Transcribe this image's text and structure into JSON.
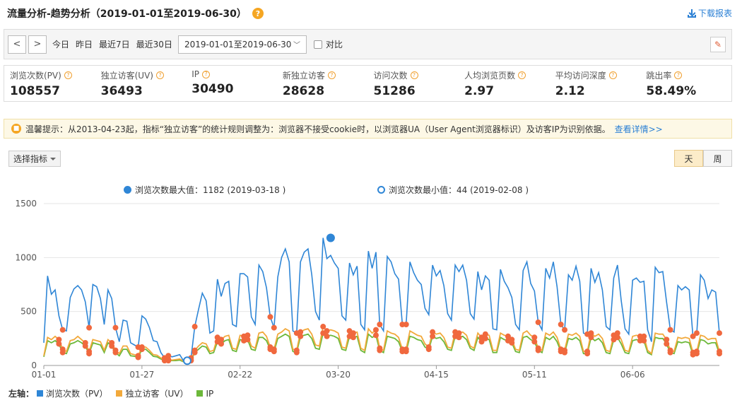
{
  "header": {
    "title": "流量分析-趋势分析（2019-01-01至2019-06-30）",
    "help": "?",
    "download": "下载报表"
  },
  "toolbar": {
    "prev": "<",
    "next": ">",
    "quick": [
      "今日",
      "昨日",
      "最近7日",
      "最近30日"
    ],
    "date_range": "2019-01-01至2019-06-30",
    "compare": "对比"
  },
  "metrics": [
    {
      "label": "浏览次数(PV)",
      "value": "108557"
    },
    {
      "label": "独立访客(UV)",
      "value": "36493"
    },
    {
      "label": "IP",
      "value": "30490"
    },
    {
      "label": "新独立访客",
      "value": "28628"
    },
    {
      "label": "访问次数",
      "value": "51286"
    },
    {
      "label": "人均浏览页数",
      "value": "2.97"
    },
    {
      "label": "平均访问深度",
      "value": "2.12"
    },
    {
      "label": "跳出率",
      "value": "58.49%"
    }
  ],
  "notice": {
    "text": "温馨提示：从2013-04-23起，指标“独立访客”的统计规则调整为：浏览器不接受cookie时，以浏览器UA（User Agent浏览器标识）及访客IP为识别依据。",
    "link": "查看详情>>"
  },
  "controls": {
    "metric_select": "选择指标",
    "granularity": [
      "天",
      "周"
    ],
    "granularity_active": "天"
  },
  "chart_legend_top": {
    "max": "浏览次数最大值：1182 (2019-03-18 )",
    "min": "浏览次数最小值：44 (2019-02-08 )"
  },
  "axis_legend": {
    "prefix": "左轴：",
    "items": [
      "浏览次数（PV）",
      "独立访客（UV）",
      "IP"
    ]
  },
  "colors": {
    "pv": "#2f86d6",
    "uv": "#f2a93b",
    "ip": "#6cb83a",
    "weekend_marker": "#f0683e"
  },
  "chart_data": {
    "type": "line",
    "title": "",
    "xlabel": "",
    "ylabel": "",
    "x_start": "2019-01-01",
    "x_end": "2019-06-30",
    "ylim": [
      0,
      1500
    ],
    "yticks": [
      0,
      500,
      1000,
      1500
    ],
    "xtick_labels": [
      "01-01",
      "01-27",
      "02-22",
      "03-20",
      "04-15",
      "05-11",
      "06-06"
    ],
    "grid": true,
    "max_point": {
      "date": "2019-03-18",
      "value": 1182
    },
    "min_point": {
      "date": "2019-02-08",
      "value": 44
    },
    "series": [
      {
        "name": "浏览次数（PV）",
        "key": "pv",
        "values": [
          210,
          830,
          660,
          700,
          460,
          330,
          320,
          630,
          710,
          740,
          700,
          590,
          350,
          750,
          730,
          620,
          380,
          700,
          620,
          350,
          220,
          420,
          410,
          210,
          190,
          170,
          460,
          430,
          350,
          230,
          220,
          120,
          70,
          90,
          80,
          90,
          100,
          44,
          50,
          70,
          360,
          520,
          670,
          600,
          300,
          320,
          800,
          640,
          760,
          780,
          380,
          360,
          850,
          850,
          820,
          450,
          380,
          930,
          870,
          720,
          450,
          350,
          820,
          1000,
          1080,
          960,
          320,
          300,
          960,
          1050,
          1080,
          840,
          500,
          420,
          1182,
          990,
          1020,
          950,
          900,
          460,
          420,
          950,
          840,
          920,
          380,
          330,
          1060,
          900,
          1050,
          380,
          320,
          1010,
          960,
          850,
          800,
          380,
          380,
          960,
          860,
          790,
          750,
          530,
          470,
          930,
          830,
          880,
          740,
          480,
          420,
          930,
          870,
          930,
          790,
          480,
          430,
          870,
          700,
          830,
          790,
          340,
          330,
          890,
          780,
          720,
          630,
          380,
          330,
          880,
          960,
          760,
          690,
          400,
          330,
          900,
          810,
          960,
          730,
          380,
          330,
          840,
          790,
          920,
          780,
          300,
          290,
          900,
          770,
          860,
          700,
          360,
          330,
          810,
          930,
          600,
          340,
          290,
          790,
          810,
          770,
          780,
          330,
          220,
          910,
          860,
          870,
          590,
          330,
          310,
          740,
          700,
          730,
          700,
          270,
          300,
          840,
          790,
          620,
          700,
          680,
          300
        ]
      },
      {
        "name": "独立访客（UV）",
        "key": "uv",
        "values": [
          90,
          260,
          240,
          270,
          240,
          150,
          130,
          230,
          240,
          270,
          240,
          210,
          130,
          240,
          230,
          220,
          140,
          240,
          210,
          140,
          110,
          180,
          180,
          110,
          100,
          90,
          170,
          170,
          140,
          100,
          95,
          70,
          50,
          55,
          50,
          55,
          60,
          40,
          40,
          50,
          140,
          180,
          210,
          200,
          130,
          140,
          260,
          240,
          270,
          280,
          160,
          150,
          280,
          270,
          280,
          180,
          160,
          300,
          310,
          270,
          170,
          150,
          290,
          310,
          340,
          320,
          150,
          140,
          310,
          330,
          340,
          290,
          190,
          180,
          360,
          320,
          330,
          320,
          300,
          170,
          160,
          320,
          300,
          310,
          160,
          140,
          340,
          300,
          330,
          160,
          140,
          320,
          300,
          290,
          260,
          150,
          150,
          320,
          300,
          280,
          270,
          200,
          170,
          310,
          290,
          300,
          260,
          170,
          160,
          310,
          300,
          310,
          280,
          180,
          160,
          300,
          260,
          290,
          280,
          140,
          140,
          300,
          280,
          270,
          240,
          150,
          140,
          300,
          320,
          280,
          260,
          160,
          140,
          300,
          280,
          310,
          260,
          150,
          140,
          290,
          280,
          300,
          270,
          130,
          130,
          300,
          270,
          290,
          250,
          140,
          130,
          280,
          300,
          240,
          140,
          130,
          270,
          280,
          270,
          270,
          140,
          110,
          300,
          290,
          290,
          240,
          140,
          130,
          260,
          250,
          260,
          250,
          120,
          130,
          280,
          270,
          240,
          250,
          250,
          130
        ]
      },
      {
        "name": "IP",
        "key": "ip",
        "values": [
          80,
          230,
          210,
          230,
          200,
          120,
          110,
          200,
          210,
          230,
          210,
          180,
          110,
          210,
          200,
          190,
          120,
          210,
          180,
          120,
          90,
          150,
          150,
          90,
          85,
          75,
          150,
          150,
          120,
          85,
          80,
          60,
          45,
          45,
          45,
          45,
          50,
          35,
          35,
          45,
          120,
          150,
          180,
          170,
          110,
          120,
          220,
          200,
          230,
          240,
          140,
          130,
          240,
          230,
          240,
          150,
          140,
          260,
          260,
          230,
          150,
          130,
          250,
          270,
          290,
          270,
          130,
          120,
          270,
          280,
          290,
          250,
          160,
          150,
          300,
          270,
          280,
          270,
          250,
          150,
          140,
          270,
          260,
          270,
          140,
          120,
          290,
          260,
          280,
          140,
          120,
          270,
          260,
          250,
          220,
          130,
          130,
          270,
          260,
          240,
          230,
          170,
          150,
          270,
          250,
          260,
          220,
          150,
          140,
          270,
          260,
          270,
          240,
          160,
          140,
          260,
          220,
          250,
          240,
          120,
          120,
          260,
          240,
          230,
          210,
          130,
          120,
          260,
          270,
          240,
          220,
          140,
          120,
          260,
          240,
          270,
          220,
          130,
          120,
          250,
          240,
          260,
          230,
          110,
          110,
          260,
          230,
          250,
          210,
          120,
          110,
          240,
          260,
          200,
          120,
          110,
          230,
          240,
          230,
          230,
          120,
          100,
          260,
          250,
          250,
          200,
          120,
          110,
          220,
          210,
          220,
          210,
          100,
          110,
          240,
          230,
          200,
          210,
          210,
          110
        ]
      }
    ]
  }
}
